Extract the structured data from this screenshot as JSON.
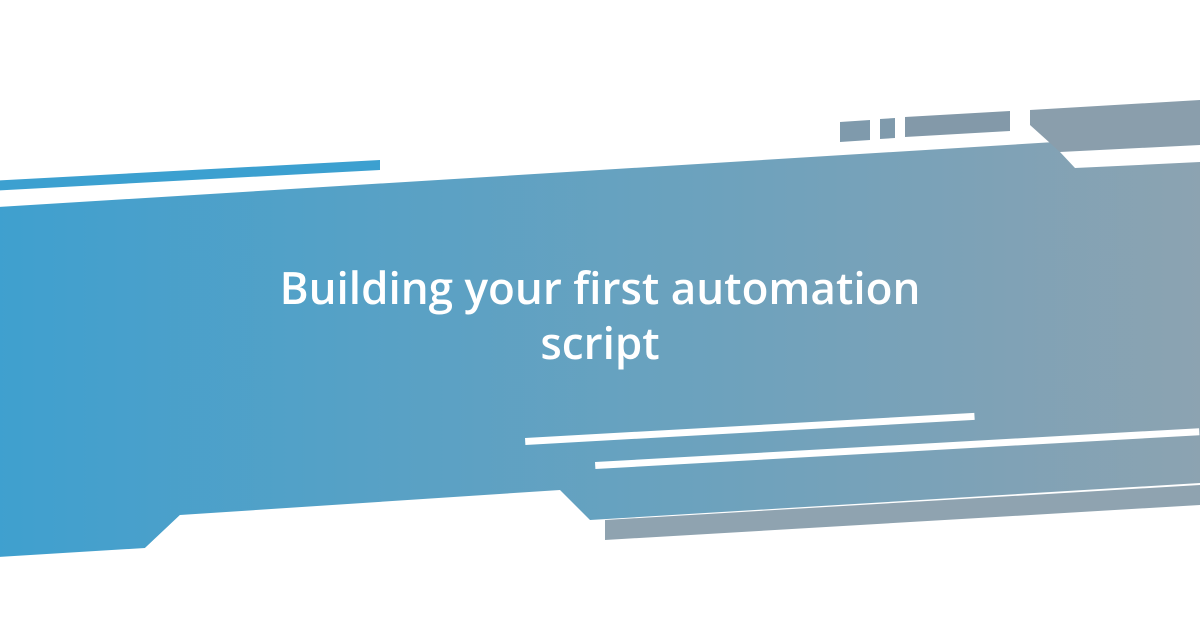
{
  "banner": {
    "title": "Building your first automation script"
  },
  "colors": {
    "gradient_start": "#3ca0d0",
    "gradient_end": "#8fa3b0",
    "background": "#ffffff"
  }
}
